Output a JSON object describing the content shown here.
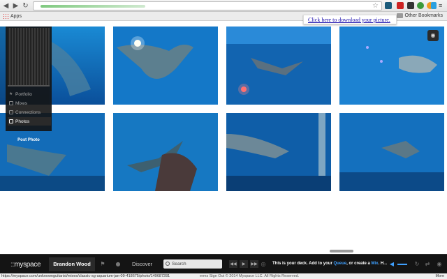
{
  "browser": {
    "bookmarks_bar": {
      "apps_label": "Apps",
      "other_label": "Other Bookmarks"
    },
    "tooltip": "Click here to download your picture."
  },
  "sidebar": {
    "items": [
      {
        "label": "Portfolio",
        "icon": "star-icon"
      },
      {
        "label": "Mixes",
        "icon": "mix-icon"
      },
      {
        "label": "Connections",
        "icon": "connections-icon"
      },
      {
        "label": "Photos",
        "icon": "photo-icon"
      }
    ],
    "post_button": "Post Photo"
  },
  "deck": {
    "logo": "myspace",
    "user": "Brandon Wood",
    "discover": "Discover",
    "search_placeholder": "Search",
    "message_prefix": "This is your deck. Add to your ",
    "message_queue": "Queue",
    "message_mid": ", or create a ",
    "message_mix": "Mix",
    "message_suffix": ". H..."
  },
  "status_bar": {
    "url": "https://myspace.com/unknownguitarist/mixes/classic-sg-aquarium-jan-09-418675/photo/149687281",
    "footer": "erms   Sign Out   © 2014 Myspace LLC. All Rights Reserved.",
    "more": "More"
  },
  "colors": {
    "accent": "#3fa0ff",
    "deck_bg": "#141414"
  }
}
